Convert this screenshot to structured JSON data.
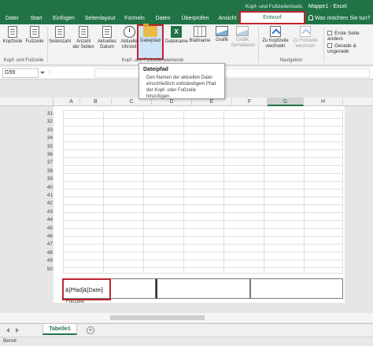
{
  "title_bar": {
    "context_tools": "Kopf- und Fußzeilentools",
    "window_title": "Mappe1 - Excel",
    "tell_me": "Was möchten Sie tun?"
  },
  "tabs": [
    {
      "label": "Datei"
    },
    {
      "label": "Start"
    },
    {
      "label": "Einfügen"
    },
    {
      "label": "Seitenlayout"
    },
    {
      "label": "Formeln"
    },
    {
      "label": "Daten"
    },
    {
      "label": "Überprüfen"
    },
    {
      "label": "Ansicht"
    },
    {
      "label": "Entwurf"
    }
  ],
  "ribbon": {
    "buttons": [
      {
        "label": "Kopfzeile",
        "icon": "page-icon"
      },
      {
        "label": "Fußzeile",
        "icon": "page-icon"
      },
      {
        "label": "Seitenzahl",
        "icon": "page-icon"
      },
      {
        "label": "Anzahl der Seiten",
        "icon": "page-icon"
      },
      {
        "label": "Aktuelles Datum",
        "icon": "page-icon"
      },
      {
        "label": "Aktuelle Uhrzeit",
        "icon": "clock-icon"
      },
      {
        "label": "Dateipfad",
        "icon": "folder-icon"
      },
      {
        "label": "Dateiname",
        "icon": "excel-sheet-icon"
      },
      {
        "label": "Blattname",
        "icon": "grid-icon"
      },
      {
        "label": "Grafik",
        "icon": "picture-icon"
      },
      {
        "label": "Grafik formatieren",
        "icon": "picture-icon"
      },
      {
        "label": "Zu Kopfzeile wechseln",
        "icon": "goto-icon"
      },
      {
        "label": "Zu Fußzeile wechseln",
        "icon": "goto-icon"
      }
    ],
    "groups": {
      "header_footer": "Kopf- und Fußzeile",
      "elements": "Kopf- und Fußzeilenelemente",
      "navigation": "Navigation"
    },
    "options": {
      "first_page": "Erste Seite anders",
      "even_odd": "Gerade & ungerade"
    }
  },
  "tooltip": {
    "title": "Dateipfad",
    "body": "Den Namen der aktuellen Datei einschließlich vollständigem Pfad der Kopf- oder Fußzeile hinzufügen."
  },
  "formula_bar": {
    "name_box": "G59",
    "fx_dots": "⋮"
  },
  "columns": [
    "A",
    "B",
    "C",
    "D",
    "E",
    "F",
    "G",
    "H"
  ],
  "rows": [
    "31",
    "32",
    "33",
    "34",
    "35",
    "36",
    "37",
    "38",
    "39",
    "40",
    "41",
    "42",
    "43",
    "44",
    "45",
    "46",
    "47",
    "48",
    "49",
    "50"
  ],
  "footer": {
    "left_text": "&[Pfad]&[Datei]",
    "label": "Fußzeile"
  },
  "sheet_tabs": [
    {
      "label": "Tabelle1"
    }
  ],
  "add_sheet": "+",
  "status": {
    "text": "Bereit"
  },
  "colors": {
    "accent": "#217346",
    "highlight": "#c0232c"
  }
}
